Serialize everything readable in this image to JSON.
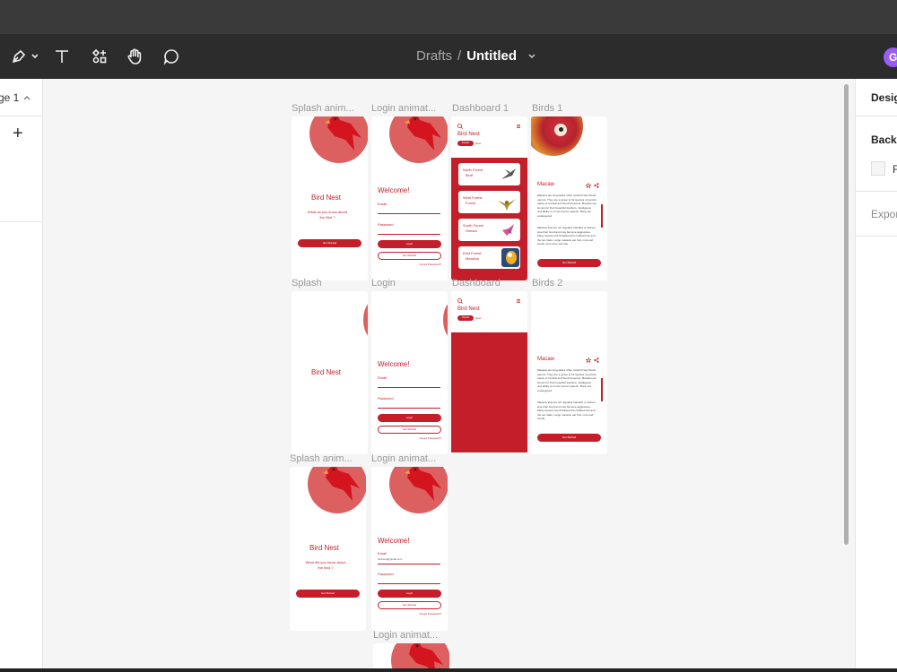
{
  "toolbar": {
    "breadcrumb_parent": "Drafts",
    "breadcrumb_sep": "/",
    "file_name": "Untitled",
    "avatar_initial": "G"
  },
  "left_panel": {
    "page_label": "ge 1",
    "add_symbol": "+"
  },
  "right_panel": {
    "design_tab": "Desig",
    "background_label": "Backg",
    "fill_letter": "F",
    "export_label": "Expor"
  },
  "frames": {
    "splash_anim1": {
      "label": "Splash anim...",
      "title": "Bird Nest",
      "subtitle_l1": "What do you know about",
      "subtitle_l2": "the Bird ?",
      "button": "Get Started"
    },
    "login_anim1": {
      "label": "Login animat...",
      "welcome": "Welcome!",
      "email": "Email",
      "password": "Password",
      "login": "Login",
      "get_started": "Get Started",
      "forgot": "Forgot Password?"
    },
    "dashboard1": {
      "label": "Dashboard 1",
      "title": "Bird Nest",
      "pill_popular": "Popular",
      "pill_new": "New",
      "cards": [
        {
          "line1": "North Forest",
          "line2": "Bluff"
        },
        {
          "line1": "West Forest",
          "line2": "Forest"
        },
        {
          "line1": "South Forest",
          "line2": "Stream"
        },
        {
          "line1": "East Forest",
          "line2": "Meadow"
        }
      ]
    },
    "birds1": {
      "label": "Birds 1",
      "name": "Macaw",
      "button": "Get Started",
      "para1": "Macaws are long-tailed, often colorful New World parrots. They are a group of 19 species of parrots native to Central and South America. Macaws are known for their beautiful feathers, intelligence and ability to mimic human speech. Many are endangered.",
      "para2": "Macaws that are not regularly handled or trained lose their bond and may become aggressive. Many species are threatened by habitat loss and the pet trade. Large macaws eat fruit, nuts and seeds, and some eat clay."
    },
    "splash": {
      "label": "Splash",
      "title": "Bird Nest"
    },
    "login": {
      "label": "Login",
      "welcome": "Welcome!",
      "email": "Email",
      "password": "Password",
      "login": "Login",
      "get_started": "Get Started",
      "forgot": "Forgot Password?"
    },
    "dashboard": {
      "label": "Dashboard",
      "title": "Bird Nest",
      "pill_popular": "Popular",
      "pill_new": "New"
    },
    "birds2": {
      "label": "Birds 2",
      "name": "Macaw",
      "button": "Get Started",
      "para1": "Macaws are long-tailed, often colorful New World parrots. They are a group of 19 species of parrots native to Central and South America. Macaws are known for their beautiful feathers, intelligence and ability to mimic human speech. Many are endangered.",
      "para2": "Macaws that are not regularly handled or trained lose their bond and may become aggressive. Many species are threatened by habitat loss and the pet trade. Large macaws eat fruit, nuts and seeds."
    },
    "splash_anim2": {
      "label": "Splash anim...",
      "title": "Bird Nest",
      "subtitle_l1": "What did you know about",
      "subtitle_l2": "the Bird ?",
      "button": "Get Started"
    },
    "login_anim2": {
      "label": "Login animat...",
      "welcome": "Welcome!",
      "email": "Email",
      "email_value": "birdnest@gmail.com",
      "password": "Password",
      "login": "Login",
      "get_started": "Get Started",
      "forgot": "Forgot Password?"
    },
    "login_anim3": {
      "label": "Login animat..."
    }
  },
  "colors": {
    "brand_red": "#c41e2a",
    "bird_circle": "#dd6060",
    "canvas": "#f5f5f5",
    "toolbar": "#2c2c2c",
    "avatar": "#9b5cf5"
  },
  "icons": [
    "pen-tool-icon",
    "text-tool-icon",
    "resources-icon",
    "hand-tool-icon",
    "comment-icon",
    "chevron-down-icon",
    "search-icon",
    "menu-icon",
    "star-icon",
    "share-icon"
  ]
}
